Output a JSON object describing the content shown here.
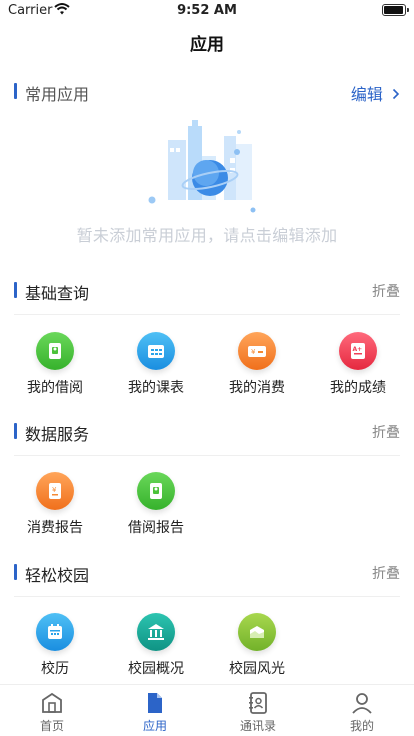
{
  "status_bar": {
    "carrier": "Carrier",
    "time": "9:52 AM"
  },
  "nav": {
    "title": "应用"
  },
  "sections": {
    "common": {
      "title": "常用应用",
      "action": "编辑",
      "empty_text": "暂未添加常用应用，请点击编辑添加"
    },
    "basic": {
      "title": "基础查询",
      "action": "折叠",
      "apps": [
        {
          "label": "我的借阅",
          "icon": "borrow-icon",
          "color": "#4cc23a"
        },
        {
          "label": "我的课表",
          "icon": "timetable-icon",
          "color": "#2aa3ea"
        },
        {
          "label": "我的消费",
          "icon": "card-icon",
          "color": "#f58a34"
        },
        {
          "label": "我的成绩",
          "icon": "grade-icon",
          "color": "#ef3f56"
        }
      ]
    },
    "data": {
      "title": "数据服务",
      "action": "折叠",
      "apps": [
        {
          "label": "消费报告",
          "icon": "consumption-report-icon",
          "color": "#f58a34"
        },
        {
          "label": "借阅报告",
          "icon": "borrow-report-icon",
          "color": "#4cc23a"
        }
      ]
    },
    "campus": {
      "title": "轻松校园",
      "action": "折叠",
      "apps": [
        {
          "label": "校历",
          "icon": "calendar-icon",
          "color": "#2aa3ea"
        },
        {
          "label": "校园概况",
          "icon": "building-icon",
          "color": "#15a99a"
        },
        {
          "label": "校园风光",
          "icon": "scenery-icon",
          "color": "#8fc73a"
        }
      ]
    }
  },
  "tabbar": {
    "items": [
      {
        "label": "首页",
        "icon": "home-icon",
        "active": false
      },
      {
        "label": "应用",
        "icon": "apps-doc-icon",
        "active": true
      },
      {
        "label": "通讯录",
        "icon": "contacts-icon",
        "active": false
      },
      {
        "label": "我的",
        "icon": "profile-icon",
        "active": false
      }
    ]
  },
  "colors": {
    "accent": "#2c64c8",
    "muted_text": "#888888",
    "empty_text": "#c9ced6"
  }
}
